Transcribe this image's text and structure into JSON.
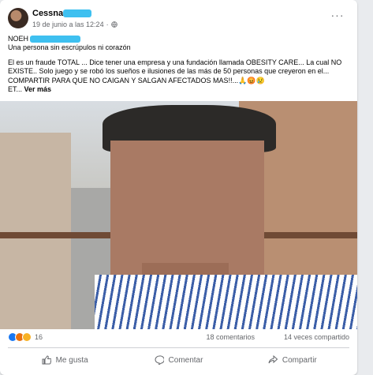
{
  "post": {
    "author": "Cessna",
    "time": "19 de junio a las 12:24",
    "more_label": "···",
    "name_prefix": "NOEH",
    "subtitle": "Una persona sin escrúpulos ni corazón",
    "text_line1": "El es un fraude TOTAL ... Dice tener una empresa y una fundación llamada OBESITY CARE... La cual NO",
    "text_line2": "EXISTE.. Solo juego y se robó los sueños e ilusiones de las más de 50 personas que creyeron en el...",
    "text_line3": "COMPARTIR PARA QUE NO CAIGAN Y SALGAN AFECTADOS MAS!!...🙏😡😢",
    "text_line4": "ET...",
    "see_more": "Ver más"
  },
  "stats": {
    "reaction_count": "16",
    "comments": "18 comentarios",
    "shares": "14 veces compartido"
  },
  "actions": {
    "like": "Me gusta",
    "comment": "Comentar",
    "share": "Compartir"
  },
  "colors": {
    "accent": "#1877f2",
    "redaction": "#3ec0f0",
    "muted": "#65676b"
  }
}
